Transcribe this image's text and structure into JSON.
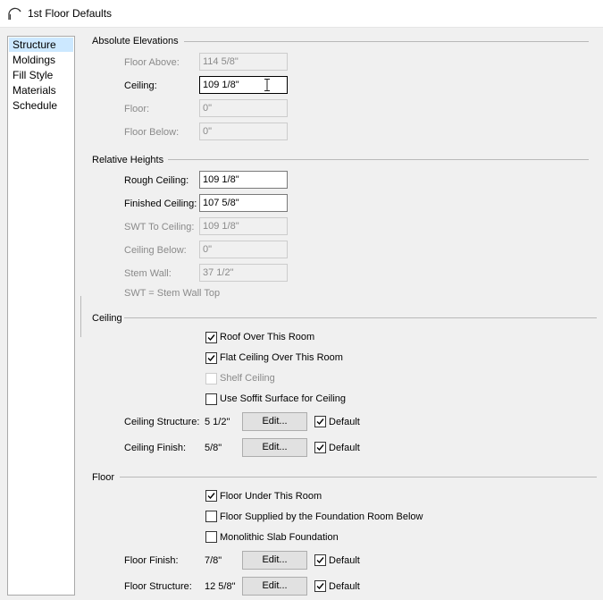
{
  "window": {
    "title": "1st Floor Defaults"
  },
  "nav": {
    "items": [
      "Structure",
      "Moldings",
      "Fill Style",
      "Materials",
      "Schedule"
    ],
    "selected": "Structure"
  },
  "absolute_elevations": {
    "title": "Absolute Elevations",
    "floor_above": {
      "label": "Floor Above:",
      "value": "114 5/8\""
    },
    "ceiling": {
      "label": "Ceiling:",
      "value": "109 1/8\""
    },
    "floor": {
      "label": "Floor:",
      "value": "0\""
    },
    "floor_below": {
      "label": "Floor Below:",
      "value": "0\""
    }
  },
  "relative_heights": {
    "title": "Relative Heights",
    "rough_ceiling": {
      "label": "Rough Ceiling:",
      "value": "109 1/8\""
    },
    "finished_ceiling": {
      "label": "Finished Ceiling:",
      "value": "107 5/8\""
    },
    "swt_to_ceiling": {
      "label": "SWT To Ceiling:",
      "value": "109 1/8\""
    },
    "ceiling_below": {
      "label": "Ceiling Below:",
      "value": "0\""
    },
    "stem_wall": {
      "label": "Stem Wall:",
      "value": "37 1/2\""
    },
    "note": "SWT = Stem Wall Top"
  },
  "ceiling_group": {
    "title": "Ceiling",
    "roof_over": {
      "label": "Roof Over This Room",
      "checked": true
    },
    "flat_ceiling": {
      "label": "Flat Ceiling Over This Room",
      "checked": true
    },
    "shelf_ceiling": {
      "label": "Shelf Ceiling",
      "checked": false
    },
    "soffit_surface": {
      "label": "Use Soffit Surface for Ceiling",
      "checked": false
    },
    "structure": {
      "label": "Ceiling Structure:",
      "value": "5 1/2\"",
      "button": "Edit...",
      "default_label": "Default",
      "default_checked": true
    },
    "finish": {
      "label": "Ceiling Finish:",
      "value": "5/8\"",
      "button": "Edit...",
      "default_label": "Default",
      "default_checked": true
    }
  },
  "floor_group": {
    "title": "Floor",
    "floor_under": {
      "label": "Floor Under This Room",
      "checked": true
    },
    "supplied_by_foundation": {
      "label": "Floor Supplied by the Foundation Room Below",
      "checked": false
    },
    "monolithic_slab": {
      "label": "Monolithic Slab Foundation",
      "checked": false
    },
    "finish": {
      "label": "Floor Finish:",
      "value": "7/8\"",
      "button": "Edit...",
      "default_label": "Default",
      "default_checked": true
    },
    "structure": {
      "label": "Floor Structure:",
      "value": "12 5/8\"",
      "button": "Edit...",
      "default_label": "Default",
      "default_checked": true
    }
  }
}
